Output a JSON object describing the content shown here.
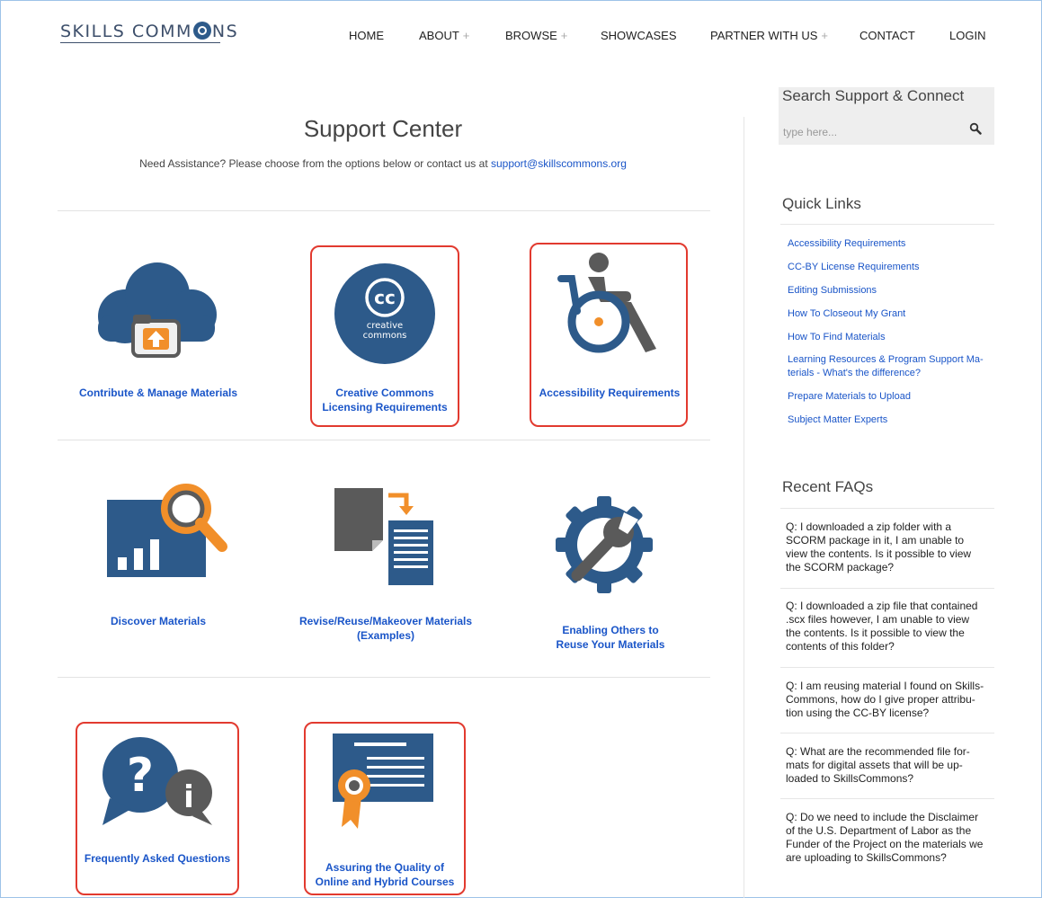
{
  "header": {
    "logo_left": "SKILLS COMM",
    "logo_right": "NS",
    "nav": [
      {
        "label": "HOME",
        "expand": ""
      },
      {
        "label": "ABOUT",
        "expand": "+"
      },
      {
        "label": "BROWSE",
        "expand": "+"
      },
      {
        "label": "SHOWCASES",
        "expand": ""
      },
      {
        "label": "PARTNER WITH US",
        "expand": "+"
      },
      {
        "label": "CONTACT",
        "expand": ""
      },
      {
        "label": "LOGIN",
        "expand": ""
      }
    ]
  },
  "main": {
    "title": "Support Center",
    "intro_text": "Need Assistance? Please choose from the options below or contact us at ",
    "intro_email": "support@skillscommons.org",
    "tiles": [
      {
        "lines": [
          "Contribute & Manage Materials"
        ],
        "icon": "cloud-upload-icon"
      },
      {
        "lines": [
          "Creative Commons",
          "Licensing Requirements"
        ],
        "icon": "creative-commons-icon",
        "highlighted": true
      },
      {
        "lines": [
          "Accessibility Requirements"
        ],
        "icon": "wheelchair-icon",
        "highlighted": true
      },
      {
        "lines": [
          "Discover Materials"
        ],
        "icon": "discover-chart-icon"
      },
      {
        "lines": [
          "Revise/Reuse/Makeover Materials",
          "(Examples)"
        ],
        "icon": "revise-documents-icon"
      },
      {
        "lines": [
          "Enabling Others to",
          "Reuse Your Materials"
        ],
        "icon": "wrench-gear-icon"
      },
      {
        "lines": [
          "Frequently Asked Questions"
        ],
        "icon": "question-info-icon",
        "highlighted": true
      },
      {
        "lines": [
          "Assuring the Quality of",
          "Online and Hybrid Courses"
        ],
        "icon": "certificate-icon",
        "highlighted": true
      }
    ],
    "cc_logo_text": "cc",
    "cc_logo_caption_1": "creative",
    "cc_logo_caption_2": "commons",
    "faq_icon_q": "?",
    "faq_icon_i": "i"
  },
  "sidebar": {
    "search_heading": "Search Support & Connect",
    "search_placeholder": "type here...",
    "quick_links_heading": "Quick Links",
    "quick_links": [
      [
        "Accessibility Requirements"
      ],
      [
        "CC-BY License Requirements"
      ],
      [
        "Editing Submissions"
      ],
      [
        "How To Closeout My Grant"
      ],
      [
        "How To Find Materials"
      ],
      [
        "Learning Resources & Program Support Ma-",
        "terials - What's the difference?"
      ],
      [
        "Prepare Materials to Upload"
      ],
      [
        "Subject Matter Experts"
      ]
    ],
    "faqs_heading": "Recent FAQs",
    "faqs": [
      [
        "Q: I downloaded a zip folder with a",
        "SCORM package in it, I am unable to",
        "view the contents. Is it possible to view",
        "the SCORM package?"
      ],
      [
        "Q: I downloaded a zip file that contained",
        ".scx files however, I am unable to view",
        "the contents. Is it possible to view the",
        "contents of this folder?"
      ],
      [
        "Q: I am reusing material I found on Skills-",
        "Commons, how do I give proper attribu-",
        "tion using the CC-BY license?"
      ],
      [
        "Q: What are the recommended file for-",
        "mats for digital assets that will be up-",
        "loaded to SkillsCommons?"
      ],
      [
        "Q: Do we need to include the Disclaimer",
        "of the U.S. Department of Labor as the",
        "Funder of the Project on the materials we",
        "are uploading to SkillsCommons?"
      ]
    ]
  },
  "colors": {
    "accent_blue": "#2d5a8a",
    "accent_orange": "#f18f2a",
    "link_blue": "#1a55c8",
    "highlight_red": "#e23a2f",
    "icon_gray": "#5a5a5a"
  }
}
